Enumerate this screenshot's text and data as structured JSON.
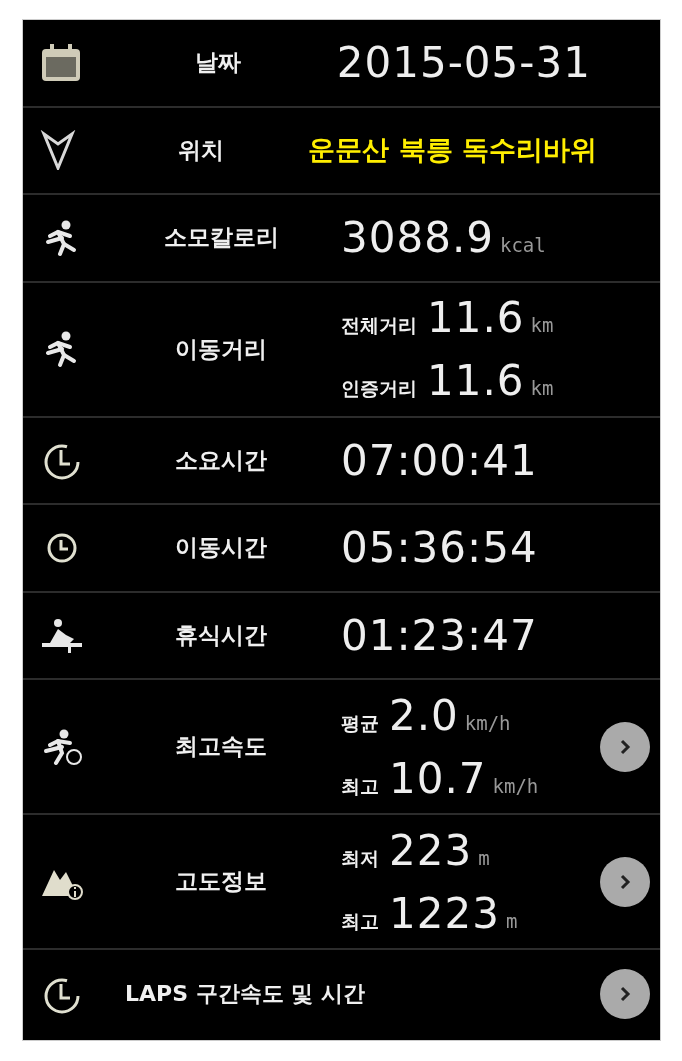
{
  "rows": [
    {
      "kind": "single",
      "label": "날짜",
      "value": "2015-05-31",
      "highlighted": false,
      "arrow": false
    },
    {
      "kind": "single",
      "label": "위치",
      "value": "운문산 북릉 독수리바위",
      "highlighted": true,
      "arrow": false
    },
    {
      "kind": "single",
      "label": "소모칼로리",
      "value": "3088.9",
      "unit": "kcal",
      "highlighted": false,
      "arrow": false
    },
    {
      "kind": "double",
      "label": "이동거리",
      "lines": [
        {
          "label": "전체거리",
          "value": "11.6",
          "unit": "km"
        },
        {
          "label": "인증거리",
          "value": "11.6",
          "unit": "km"
        }
      ],
      "arrow": false
    },
    {
      "kind": "single",
      "label": "소요시간",
      "value": "07:00:41",
      "highlighted": false,
      "arrow": false
    },
    {
      "kind": "single",
      "label": "이동시간",
      "value": "05:36:54",
      "highlighted": false,
      "arrow": false
    },
    {
      "kind": "single",
      "label": "휴식시간",
      "value": "01:23:47",
      "highlighted": false,
      "arrow": false
    },
    {
      "kind": "double",
      "label": "최고속도",
      "lines": [
        {
          "label": "평균",
          "value": "2.0",
          "unit": "km/h"
        },
        {
          "label": "최고",
          "value": "10.7",
          "unit": "km/h"
        }
      ],
      "arrow": true
    },
    {
      "kind": "double",
      "label": "고도정보",
      "lines": [
        {
          "label": "최저",
          "value": "223",
          "unit": "m"
        },
        {
          "label": "최고",
          "value": "1223",
          "unit": "m"
        }
      ],
      "arrow": true
    },
    {
      "kind": "link",
      "label": "LAPS 구간속도 및 시간",
      "arrow": true
    }
  ]
}
